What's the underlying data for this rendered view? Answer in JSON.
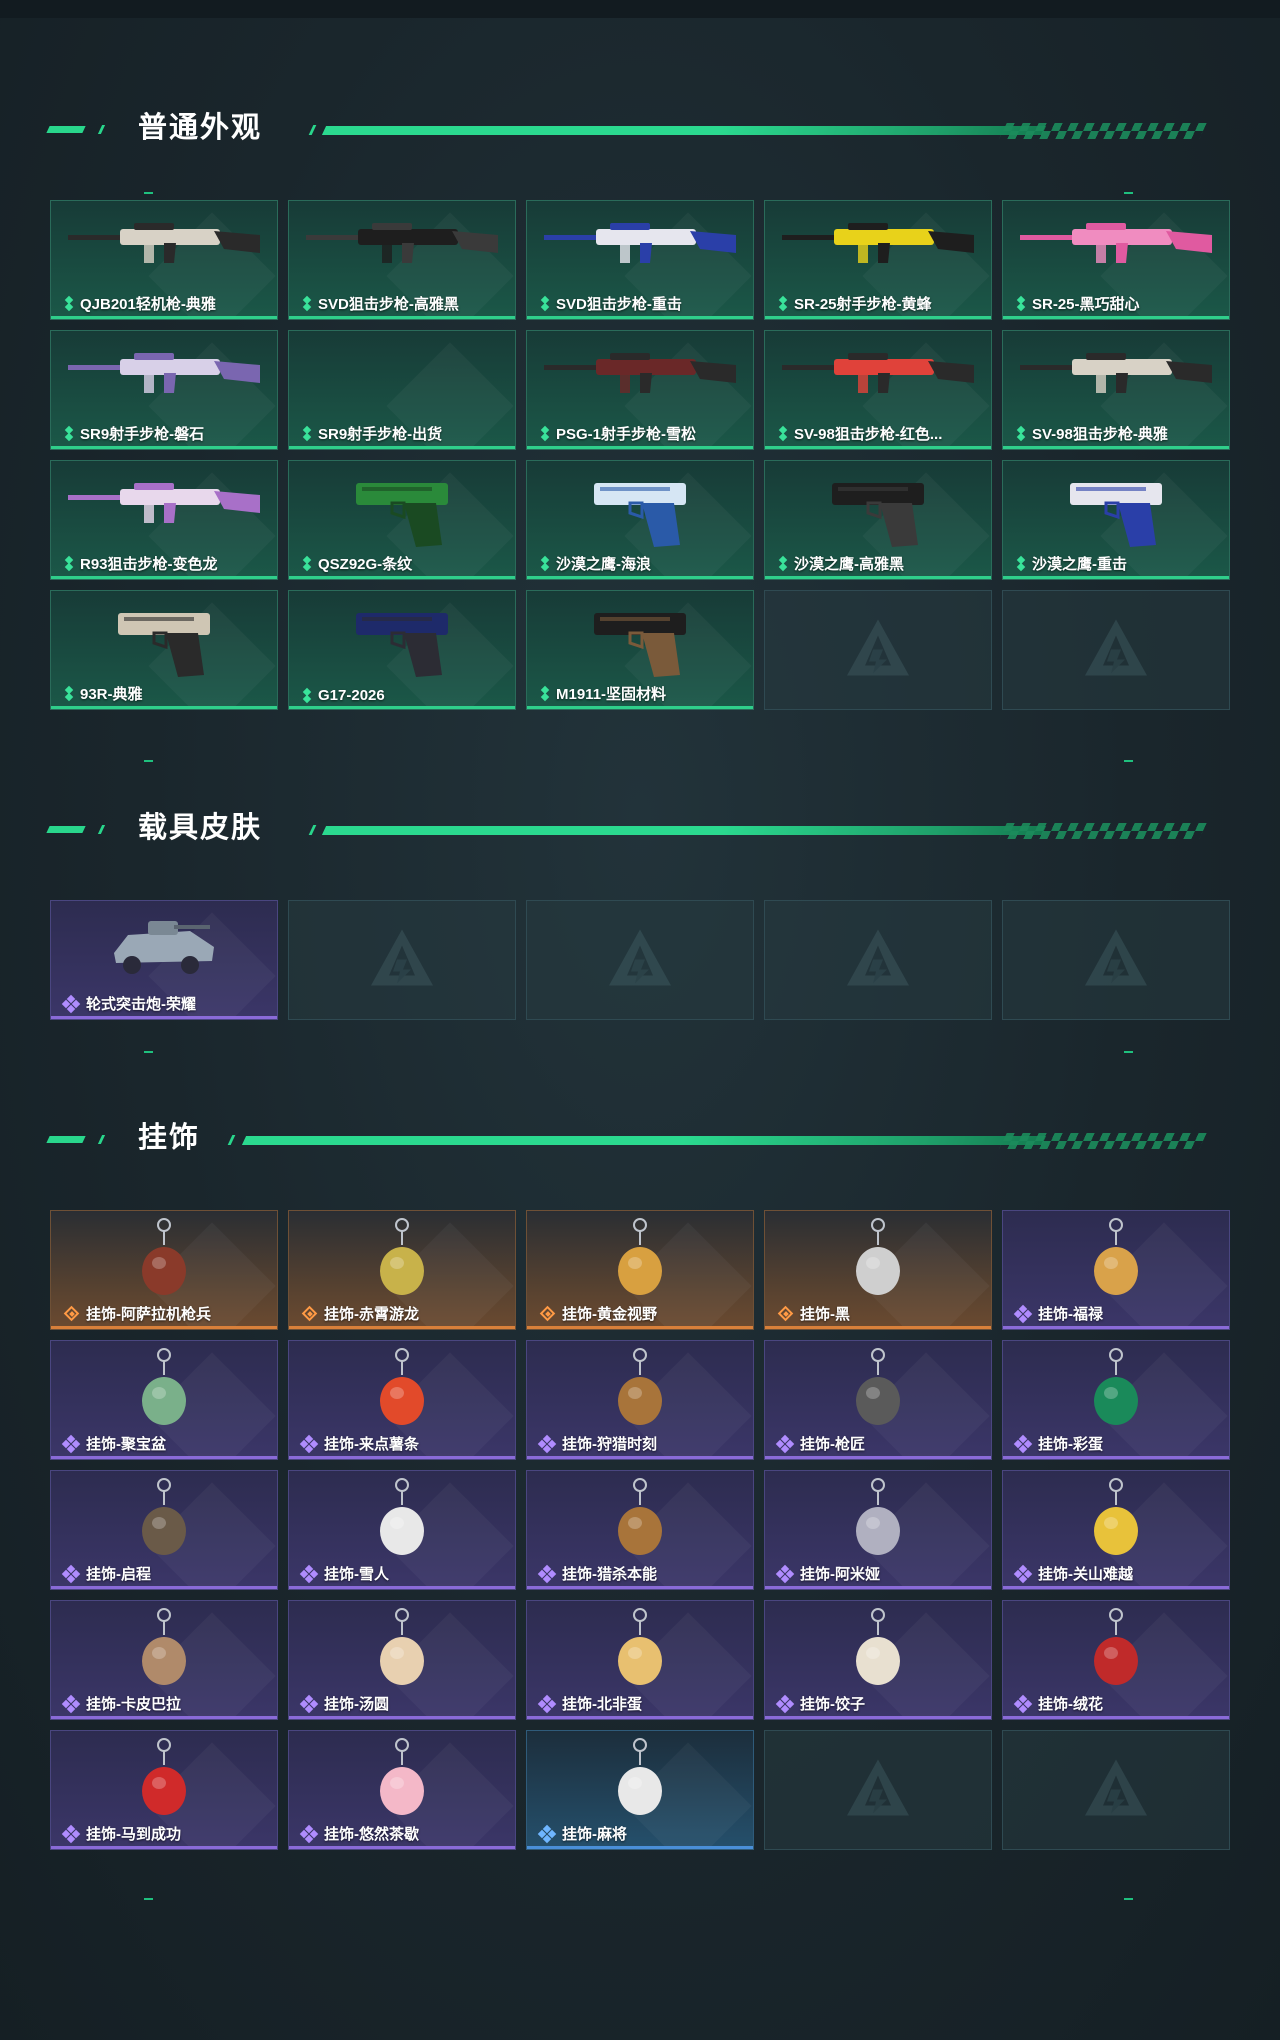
{
  "sections": {
    "weapons": {
      "title": "普通外观",
      "items": [
        {
          "label": "QJB201轻机枪-典雅",
          "colors": [
            "#d8d2c6",
            "#2a2a2a"
          ]
        },
        {
          "label": "SVD狙击步枪-高雅黑",
          "colors": [
            "#1e1e1e",
            "#3a3a3a"
          ]
        },
        {
          "label": "SVD狙击步枪-重击",
          "colors": [
            "#e6e6ee",
            "#2a3fa8"
          ]
        },
        {
          "label": "SR-25射手步枪-黄蜂",
          "colors": [
            "#e8d21a",
            "#1e1e1e"
          ]
        },
        {
          "label": "SR-25-黑巧甜心",
          "colors": [
            "#f08cc0",
            "#e05aa0"
          ]
        },
        {
          "label": "SR9射手步枪-磐石",
          "colors": [
            "#d8d0e8",
            "#7a66b0"
          ]
        },
        {
          "label": "SR9射手步枪-出货",
          "colors": []
        },
        {
          "label": "PSG-1射手步枪-雪松",
          "colors": [
            "#6a2828",
            "#2a2a2a"
          ]
        },
        {
          "label": "SV-98狙击步枪-红色...",
          "colors": [
            "#e0423a",
            "#2a2a2a"
          ]
        },
        {
          "label": "SV-98狙击步枪-典雅",
          "colors": [
            "#d8d2c6",
            "#2a2a2a"
          ]
        },
        {
          "label": "R93狙击步枪-变色龙",
          "colors": [
            "#e8d8ec",
            "#a870c8"
          ]
        },
        {
          "label": "QSZ92G-条纹",
          "colors": [
            "#2a8a3a",
            "#1a4a22"
          ]
        },
        {
          "label": "沙漠之鹰-海浪",
          "colors": [
            "#d6e6f4",
            "#2a5aa8"
          ]
        },
        {
          "label": "沙漠之鹰-高雅黑",
          "colors": [
            "#1e1e1e",
            "#3a3a3a"
          ]
        },
        {
          "label": "沙漠之鹰-重击",
          "colors": [
            "#e6e6ee",
            "#2a3fa8"
          ]
        },
        {
          "label": "93R-典雅",
          "colors": [
            "#cfc6b4",
            "#2a2a2a"
          ]
        },
        {
          "label": "G17-2026",
          "colors": [
            "#1e2a6a",
            "#2c2c34"
          ]
        },
        {
          "label": "M1911-坚固材料",
          "colors": [
            "#1e1e1e",
            "#7a5a3a"
          ]
        },
        {
          "label": "",
          "colors": []
        },
        {
          "label": "",
          "colors": []
        }
      ]
    },
    "vehicles": {
      "title": "载具皮肤",
      "items": [
        {
          "label": "轮式突击炮-荣耀",
          "colors": [
            "#9aa8b6",
            "#2a2a3a"
          ]
        },
        {
          "label": "",
          "colors": []
        },
        {
          "label": "",
          "colors": []
        },
        {
          "label": "",
          "colors": []
        },
        {
          "label": "",
          "colors": []
        }
      ]
    },
    "charms": {
      "title": "挂饰",
      "items": [
        {
          "label": "挂饰-阿萨拉机枪兵",
          "rarity": "orange"
        },
        {
          "label": "挂饰-赤霄游龙",
          "rarity": "orange"
        },
        {
          "label": "挂饰-黄金视野",
          "rarity": "orange"
        },
        {
          "label": "挂饰-黑",
          "rarity": "orange"
        },
        {
          "label": "挂饰-福禄",
          "rarity": "purple"
        },
        {
          "label": "挂饰-聚宝盆",
          "rarity": "purple"
        },
        {
          "label": "挂饰-来点薯条",
          "rarity": "purple"
        },
        {
          "label": "挂饰-狩猎时刻",
          "rarity": "purple"
        },
        {
          "label": "挂饰-枪匠",
          "rarity": "purple"
        },
        {
          "label": "挂饰-彩蛋",
          "rarity": "purple"
        },
        {
          "label": "挂饰-启程",
          "rarity": "purple"
        },
        {
          "label": "挂饰-雪人",
          "rarity": "purple"
        },
        {
          "label": "挂饰-猎杀本能",
          "rarity": "purple"
        },
        {
          "label": "挂饰-阿米娅",
          "rarity": "purple"
        },
        {
          "label": "挂饰-关山难越",
          "rarity": "purple"
        },
        {
          "label": "挂饰-卡皮巴拉",
          "rarity": "purple"
        },
        {
          "label": "挂饰-汤圆",
          "rarity": "purple"
        },
        {
          "label": "挂饰-北非蛋",
          "rarity": "purple"
        },
        {
          "label": "挂饰-饺子",
          "rarity": "purple"
        },
        {
          "label": "挂饰-绒花",
          "rarity": "purple"
        },
        {
          "label": "挂饰-马到成功",
          "rarity": "purple"
        },
        {
          "label": "挂饰-悠然茶歇",
          "rarity": "purple"
        },
        {
          "label": "挂饰-麻将",
          "rarity": "blue"
        },
        {
          "label": "",
          "rarity": "empty"
        },
        {
          "label": "",
          "rarity": "empty"
        }
      ]
    }
  }
}
